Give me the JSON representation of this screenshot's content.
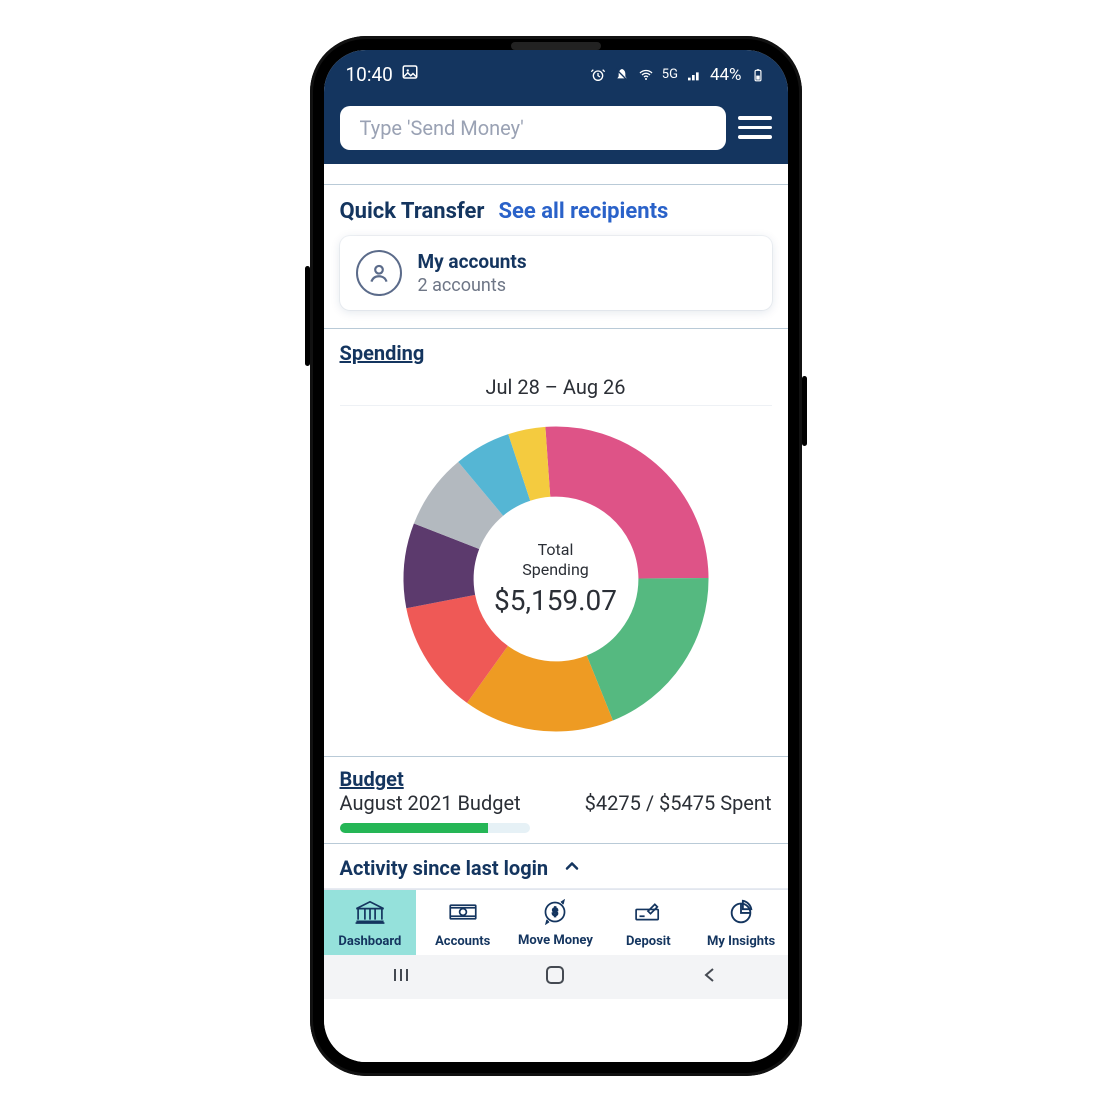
{
  "statusbar": {
    "time": "10:40",
    "battery_text": "44%",
    "network_label": "5G"
  },
  "search": {
    "placeholder": "Type 'Send Money'"
  },
  "quick_transfer": {
    "title": "Quick Transfer",
    "link_text": "See all recipients",
    "card": {
      "name": "My accounts",
      "sub": "2 accounts"
    }
  },
  "spending": {
    "title": "Spending",
    "range": "Jul 28 – Aug 26",
    "center_label_line1": "Total",
    "center_label_line2": "Spending",
    "total": "$5,159.07"
  },
  "chart_data": {
    "type": "pie",
    "categories": [
      "Pink",
      "Green",
      "Orange",
      "Red",
      "Purple",
      "Gray",
      "Teal",
      "Yellow"
    ],
    "values": [
      26,
      19,
      16,
      12,
      9,
      8,
      6,
      4
    ],
    "colors": [
      "#de5387",
      "#55b980",
      "#ee9b23",
      "#ef5956",
      "#5c3a6d",
      "#b3b9bf",
      "#55b6d4",
      "#f4cb3f"
    ],
    "title": "Total Spending $5,159.07"
  },
  "budget": {
    "title": "Budget",
    "period": "August 2021 Budget",
    "spent_text": "$4275 / $5475 Spent",
    "progress_fraction": 0.78
  },
  "activity": {
    "title": "Activity since last login"
  },
  "tabs": {
    "0": {
      "label": "Dashboard"
    },
    "1": {
      "label": "Accounts"
    },
    "2": {
      "label": "Move Money"
    },
    "3": {
      "label": "Deposit"
    },
    "4": {
      "label": "My Insights"
    }
  }
}
